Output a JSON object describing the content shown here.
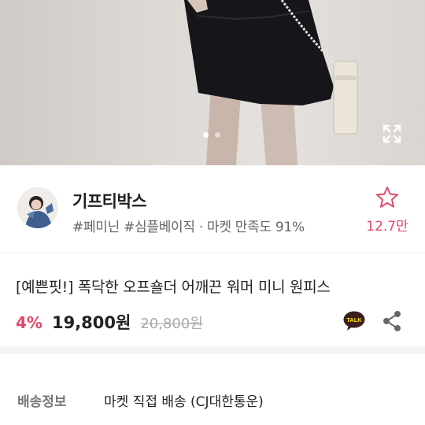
{
  "shop": {
    "name": "기프티박스",
    "tags": "#페미닌 #심플베이직 · 마켓 만족도 91%",
    "wish_count": "12.7만"
  },
  "product": {
    "title": "[예쁜핏!] 폭닥한 오프숄더 어깨끈 워머 미니 원피스",
    "discount": "4%",
    "price": "19,800원",
    "original_price": "20,800원",
    "talk_badge": "TALK"
  },
  "shipping": {
    "label": "배송정보",
    "value": "마켓 직접 배송 (CJ대한통운)"
  },
  "gallery": {
    "slide_count": 2,
    "active_slide": 1
  },
  "colors": {
    "accent_pink": "#e04a6a",
    "talk_yellow": "#3c1e1e"
  },
  "icons": {
    "wishlist": "star-outline-icon",
    "expand": "expand-icon",
    "talk": "kakaotalk-icon",
    "share": "share-icon"
  }
}
